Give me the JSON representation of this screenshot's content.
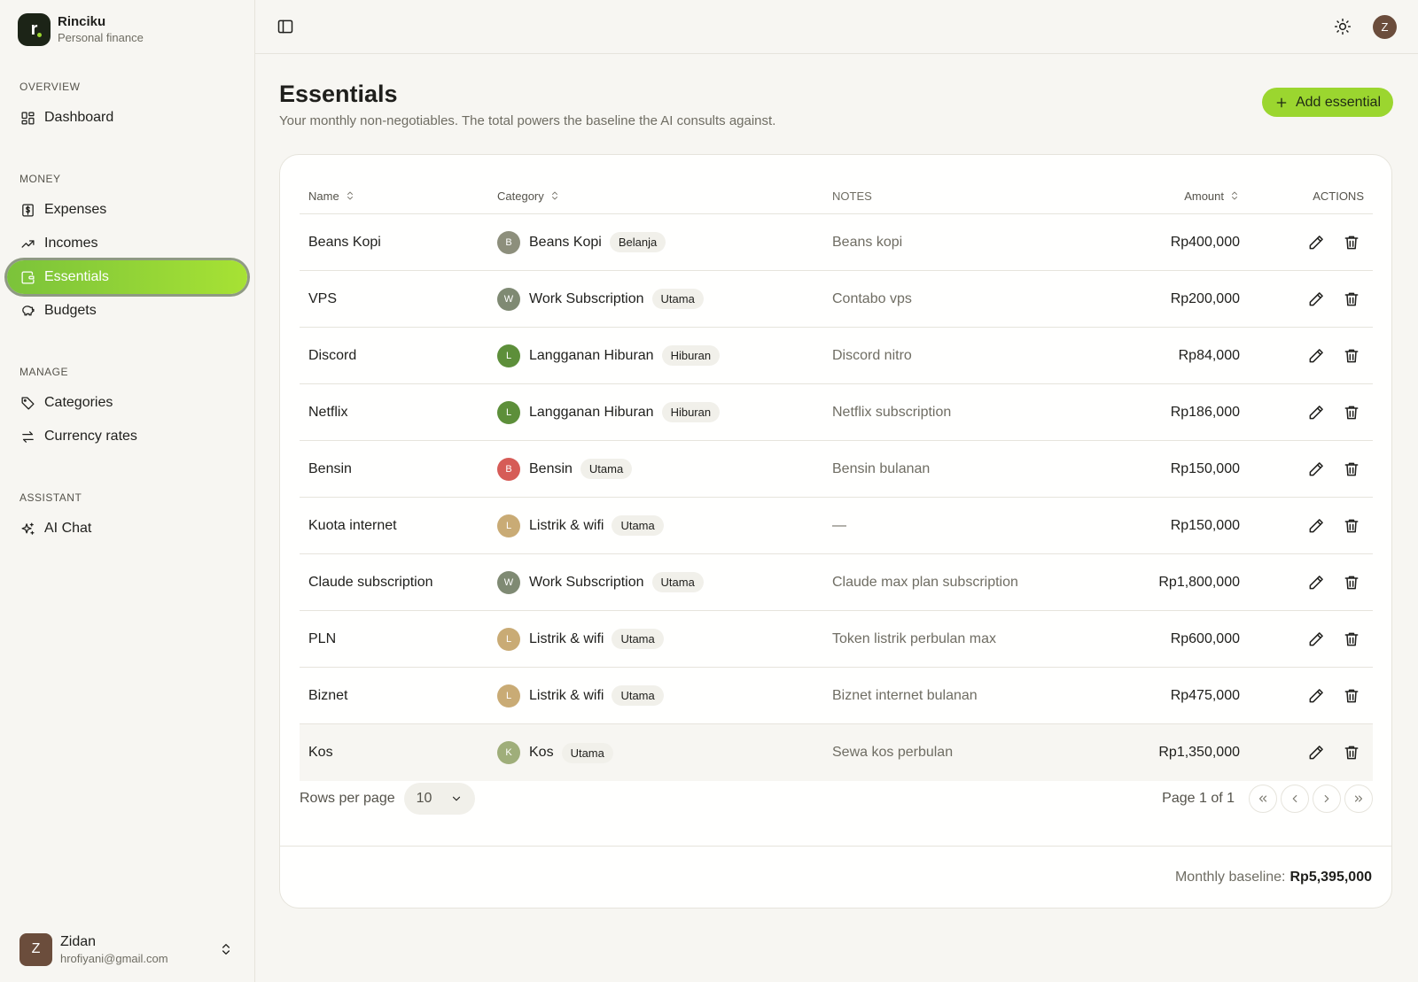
{
  "brand": {
    "title": "Rinciku",
    "subtitle": "Personal finance",
    "logo_letter": "r"
  },
  "sidebar": {
    "groups": [
      {
        "label": "OVERVIEW",
        "items": [
          {
            "label": "Dashboard",
            "icon": "dashboard-icon"
          }
        ]
      },
      {
        "label": "MONEY",
        "items": [
          {
            "label": "Expenses",
            "icon": "receipt-dollar-icon"
          },
          {
            "label": "Incomes",
            "icon": "trending-up-icon"
          },
          {
            "label": "Essentials",
            "icon": "wallet-icon",
            "active": true
          },
          {
            "label": "Budgets",
            "icon": "piggy-bank-icon"
          }
        ]
      },
      {
        "label": "MANAGE",
        "items": [
          {
            "label": "Categories",
            "icon": "tag-icon"
          },
          {
            "label": "Currency rates",
            "icon": "arrows-exchange-icon"
          }
        ]
      },
      {
        "label": "ASSISTANT",
        "items": [
          {
            "label": "AI Chat",
            "icon": "sparkles-icon"
          }
        ]
      }
    ]
  },
  "user": {
    "initial": "Z",
    "name": "Zidan",
    "email": "hrofiyani@gmail.com"
  },
  "topbar": {
    "avatar_initial": "Z"
  },
  "page": {
    "title": "Essentials",
    "subtitle": "Your monthly non-negotiables. The total powers the baseline the AI consults against.",
    "add_label": "Add essential"
  },
  "table": {
    "headers": {
      "name": "Name",
      "category": "Category",
      "notes": "NOTES",
      "amount": "Amount",
      "actions": "ACTIONS"
    },
    "rows": [
      {
        "name": "Beans Kopi",
        "cat_initial": "B",
        "cat_color": "#8d8f7c",
        "category": "Beans Kopi",
        "badge": "Belanja",
        "notes": "Beans kopi",
        "amount": "Rp400,000"
      },
      {
        "name": "VPS",
        "cat_initial": "W",
        "cat_color": "#7f8a73",
        "category": "Work Subscription",
        "badge": "Utama",
        "notes": "Contabo vps",
        "amount": "Rp200,000"
      },
      {
        "name": "Discord",
        "cat_initial": "L",
        "cat_color": "#5d8f3a",
        "category": "Langganan Hiburan",
        "badge": "Hiburan",
        "notes": "Discord nitro",
        "amount": "Rp84,000"
      },
      {
        "name": "Netflix",
        "cat_initial": "L",
        "cat_color": "#5d8f3a",
        "category": "Langganan Hiburan",
        "badge": "Hiburan",
        "notes": "Netflix subscription",
        "amount": "Rp186,000"
      },
      {
        "name": "Bensin",
        "cat_initial": "B",
        "cat_color": "#d65c57",
        "category": "Bensin",
        "badge": "Utama",
        "notes": "Bensin bulanan",
        "amount": "Rp150,000"
      },
      {
        "name": "Kuota internet",
        "cat_initial": "L",
        "cat_color": "#c9ab75",
        "category": "Listrik & wifi",
        "badge": "Utama",
        "notes": "—",
        "amount": "Rp150,000"
      },
      {
        "name": "Claude subscription",
        "cat_initial": "W",
        "cat_color": "#7f8a73",
        "category": "Work Subscription",
        "badge": "Utama",
        "notes": "Claude max plan subscription",
        "amount": "Rp1,800,000"
      },
      {
        "name": "PLN",
        "cat_initial": "L",
        "cat_color": "#c9ab75",
        "category": "Listrik & wifi",
        "badge": "Utama",
        "notes": "Token listrik perbulan max",
        "amount": "Rp600,000"
      },
      {
        "name": "Biznet",
        "cat_initial": "L",
        "cat_color": "#c9ab75",
        "category": "Listrik & wifi",
        "badge": "Utama",
        "notes": "Biznet internet bulanan",
        "amount": "Rp475,000"
      },
      {
        "name": "Kos",
        "cat_initial": "K",
        "cat_color": "#9fae7a",
        "category": "Kos",
        "badge": "Utama",
        "notes": "Sewa kos perbulan",
        "amount": "Rp1,350,000"
      }
    ]
  },
  "pager": {
    "rows_label": "Rows per page",
    "rows_value": "10",
    "page_info": "Page 1 of 1"
  },
  "footer": {
    "baseline_label": "Monthly baseline:",
    "baseline_value": "Rp5,395,000"
  }
}
